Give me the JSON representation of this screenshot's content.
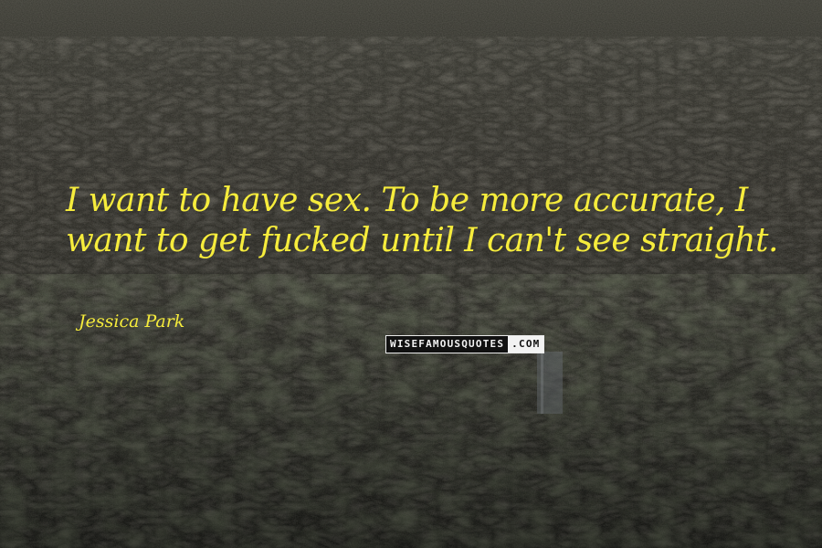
{
  "quote": {
    "lines": [
      "I want to have sex. To be more accurate, I",
      "want to get fucked until I can't see straight."
    ]
  },
  "author": "Jessica Park",
  "watermark": {
    "name": "WISEFAMOUSQUOTES",
    "tld": ".COM"
  },
  "colors": {
    "quote_text": "#f6ec3c",
    "background_dark": "#1c1c17",
    "watermark_bg": "#111111",
    "watermark_text": "#f2f2f2"
  },
  "background_description_icon": "city-skyline-photo"
}
